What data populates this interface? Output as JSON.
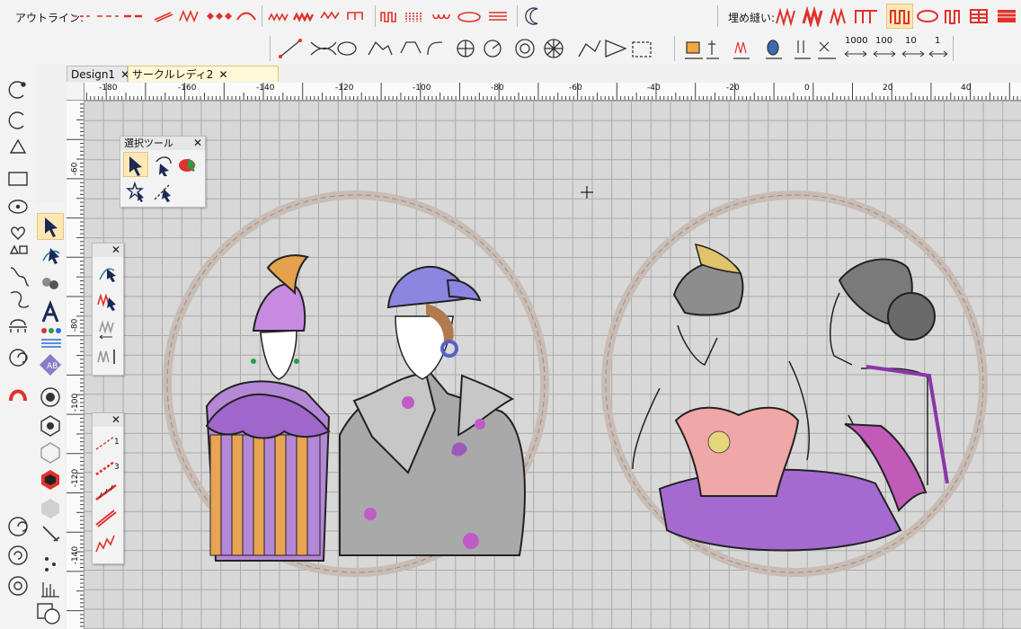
{
  "toolbar_top": {
    "outline_label": "アウトライン:",
    "fill_label": "埋め縫い:",
    "stitch_counts": [
      "1000",
      "100",
      "10",
      "1"
    ]
  },
  "tabs": [
    {
      "label": "Design1",
      "close": "✕"
    },
    {
      "label": "サークルレディ2",
      "close": "✕"
    }
  ],
  "ruler": {
    "top_ticks": [
      "-180",
      "-160",
      "-140",
      "-120",
      "-100",
      "-80",
      "-60",
      "-40",
      "-20",
      "0",
      "20",
      "40"
    ],
    "left_ticks": [
      "-60",
      "-80",
      "-100",
      "-120",
      "-140"
    ]
  },
  "select_palette": {
    "title": "選択ツール",
    "close": "✕"
  },
  "palette2": {
    "close": "✕"
  },
  "palette3": {
    "close": "✕",
    "labels": [
      "1",
      "3"
    ]
  },
  "colors": {
    "accent": "#e0312a",
    "selected_bg": "#fde7b4",
    "ring": "#c9bcb5",
    "purple": "#a46ad0",
    "orange": "#e5a24c",
    "pink": "#f0a7a7"
  }
}
